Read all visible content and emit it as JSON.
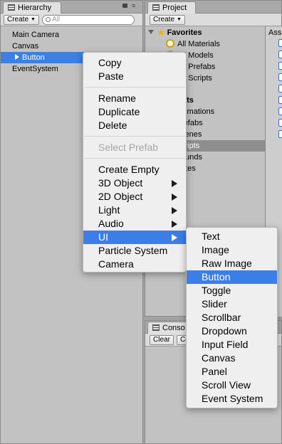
{
  "hierarchy": {
    "tab_label": "Hierarchy",
    "create_label": "Create",
    "search_placeholder": "All",
    "items": [
      {
        "label": "Main Camera"
      },
      {
        "label": "Canvas"
      },
      {
        "label": "Button"
      },
      {
        "label": "EventSystem"
      }
    ]
  },
  "project": {
    "tab_label": "Project",
    "create_label": "Create",
    "favorites_label": "Favorites",
    "favorites": [
      "All Materials",
      "All Models",
      "All Prefabs",
      "All Scripts"
    ],
    "assets_label": "ets",
    "folders": [
      "nimations",
      "refabs",
      "cenes",
      "cripts",
      "ounds",
      "rites"
    ],
    "asset_column_label": "Ass"
  },
  "console": {
    "tab_label": "Conso",
    "clear_label": "Clear",
    "collapse_label": "Co"
  },
  "context_menu": {
    "copy": "Copy",
    "paste": "Paste",
    "rename": "Rename",
    "duplicate": "Duplicate",
    "delete": "Delete",
    "select_prefab": "Select Prefab",
    "create_empty": "Create Empty",
    "obj3d": "3D Object",
    "obj2d": "2D Object",
    "light": "Light",
    "audio": "Audio",
    "ui": "UI",
    "particle_system": "Particle System",
    "camera": "Camera"
  },
  "ui_submenu": {
    "items": [
      "Text",
      "Image",
      "Raw Image",
      "Button",
      "Toggle",
      "Slider",
      "Scrollbar",
      "Dropdown",
      "Input Field",
      "Canvas",
      "Panel",
      "Scroll View",
      "Event System"
    ],
    "highlighted": "Button"
  },
  "colors": {
    "selection": "#3d80df",
    "menu_highlight": "#3c7ee8",
    "panel": "#c2c2c2"
  }
}
